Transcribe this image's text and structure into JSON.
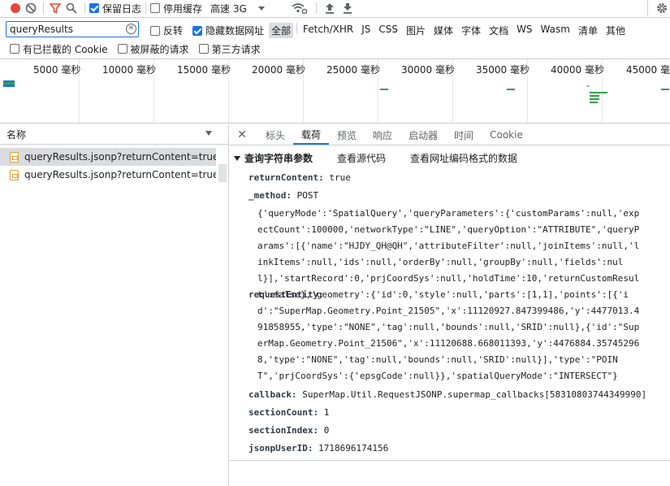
{
  "toolbar": {
    "preserve_log_label": "保留日志",
    "preserve_log_checked": true,
    "disable_cache_label": "停用缓存",
    "disable_cache_checked": false,
    "throttling_value": "高速 3G"
  },
  "filter": {
    "value": "queryResults",
    "invert_label": "反转",
    "invert_checked": false,
    "hide_data_urls_label": "隐藏数据网址",
    "hide_data_urls_checked": true,
    "types": [
      "全部",
      "Fetch/XHR",
      "JS",
      "CSS",
      "图片",
      "媒体",
      "字体",
      "文档",
      "WS",
      "Wasm",
      "清单",
      "其他"
    ],
    "active_type": "全部"
  },
  "filter2": {
    "blocked_cookies_label": "有已拦截的 Cookie",
    "blocked_requests_label": "被屏蔽的请求",
    "third_party_label": "第三方请求"
  },
  "overview": {
    "ticks": [
      "5000 毫秒",
      "10000 毫秒",
      "15000 毫秒",
      "20000 毫秒",
      "25000 毫秒",
      "30000 毫秒",
      "35000 毫秒",
      "40000 毫秒",
      "45000 毫秒"
    ]
  },
  "request_list": {
    "header": "名称",
    "rows": [
      {
        "name": "queryResults.jsonp?returnContent=true&_..."
      },
      {
        "name": "queryResults.jsonp?returnContent=true&_..."
      }
    ]
  },
  "detail": {
    "close_glyph": "✕",
    "tabs": [
      "标头",
      "载荷",
      "预览",
      "响应",
      "启动器",
      "时间",
      "Cookie"
    ],
    "active_tab": "载荷",
    "section_title": "查询字符串参数",
    "view_source": "查看源代码",
    "view_url_encoded": "查看网址编码格式的数据",
    "params": {
      "returnContent_key": "returnContent:",
      "returnContent_val": "true",
      "method_key": "_method:",
      "method_val": "POST",
      "request_entity_key": "requestEntity:",
      "json_lines": [
        "{'queryMode':'SpatialQuery','queryParameters':{'customParams':null,'exp",
        "ectCount':100000,'networkType':\"LINE\",'queryOption':\"ATTRIBUTE\",'queryP",
        "arams':[{'name':\"HJDY_QH@QH\",'attributeFilter':null,'joinItems':null,'l",
        "inkItems':null,'ids':null,'orderBy':null,'groupBy':null,'fields':nul",
        "l}],'startRecord':0,'prjCoordSys':null,'holdTime':10,'returnCustomResul",
        "t':false},'geometry':{'id':0,'style':null,'parts':[1,1],'points':[{'i",
        "d':\"SuperMap.Geometry.Point_21505\",'x':11120927.847399486,'y':4477013.4",
        "91858955,'type':\"NONE\",'tag':null,'bounds':null,'SRID':null},{'id':\"Sup",
        "erMap.Geometry.Point_21506\",'x':11120688.668011393,'y':4476884.35745296",
        "8,'type':\"NONE\",'tag':null,'bounds':null,'SRID':null}],'type':\"POIN",
        "T\",'prjCoordSys':{'epsgCode':null}},'spatialQueryMode':\"INTERSECT\"}"
      ],
      "callback_key": "callback:",
      "callback_val": "SuperMap.Util.RequestJSONP.supermap_callbacks[58310803744349990]",
      "sectionCount_key": "sectionCount:",
      "sectionCount_val": "1",
      "sectionIndex_key": "sectionIndex:",
      "sectionIndex_val": "0",
      "jsonpUserID_key": "jsonpUserID:",
      "jsonpUserID_val": "1718696174156"
    }
  },
  "colors": {
    "accent": "#1a73e8",
    "record": "#e8453c",
    "waterfall": "#2fa24a"
  }
}
